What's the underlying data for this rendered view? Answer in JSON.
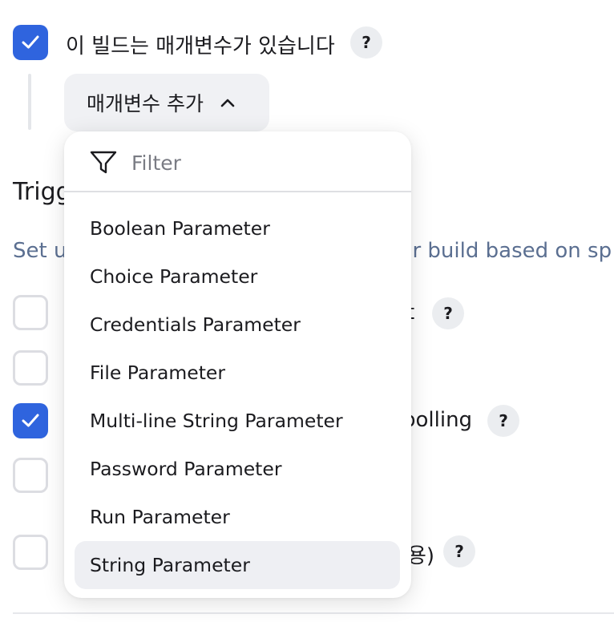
{
  "params_option": {
    "checked": true,
    "label": "이 빌드는 매개변수가 있습니다",
    "help": "?"
  },
  "add_param_button": {
    "label": "매개변수 추가"
  },
  "triggers": {
    "title_visible": "Trigg",
    "description_left": "Set u",
    "description_right": "ur build based on sp",
    "options": [
      {
        "checked": false,
        "label_fragment": "t",
        "help": "?"
      },
      {
        "checked": false,
        "label_fragment": ""
      },
      {
        "checked": true,
        "label_fragment": "polling",
        "help": "?"
      },
      {
        "checked": false,
        "label_fragment": ""
      },
      {
        "checked": false,
        "label_fragment": "용)",
        "help": "?"
      }
    ]
  },
  "dropdown": {
    "filter_placeholder": "Filter",
    "items": [
      {
        "label": "Boolean Parameter"
      },
      {
        "label": "Choice Parameter"
      },
      {
        "label": "Credentials Parameter"
      },
      {
        "label": "File Parameter"
      },
      {
        "label": "Multi-line String Parameter"
      },
      {
        "label": "Password Parameter"
      },
      {
        "label": "Run Parameter"
      },
      {
        "label": "String Parameter",
        "hovered": true
      }
    ]
  },
  "colors": {
    "accent": "#2f64de",
    "description_text": "#5b6f91",
    "hover_background": "#eeeff3"
  },
  "icons": {
    "checkbox_mark": "checkmark-icon",
    "dropdown_toggle": "chevron-up-icon",
    "filter": "filter-funnel-icon"
  }
}
